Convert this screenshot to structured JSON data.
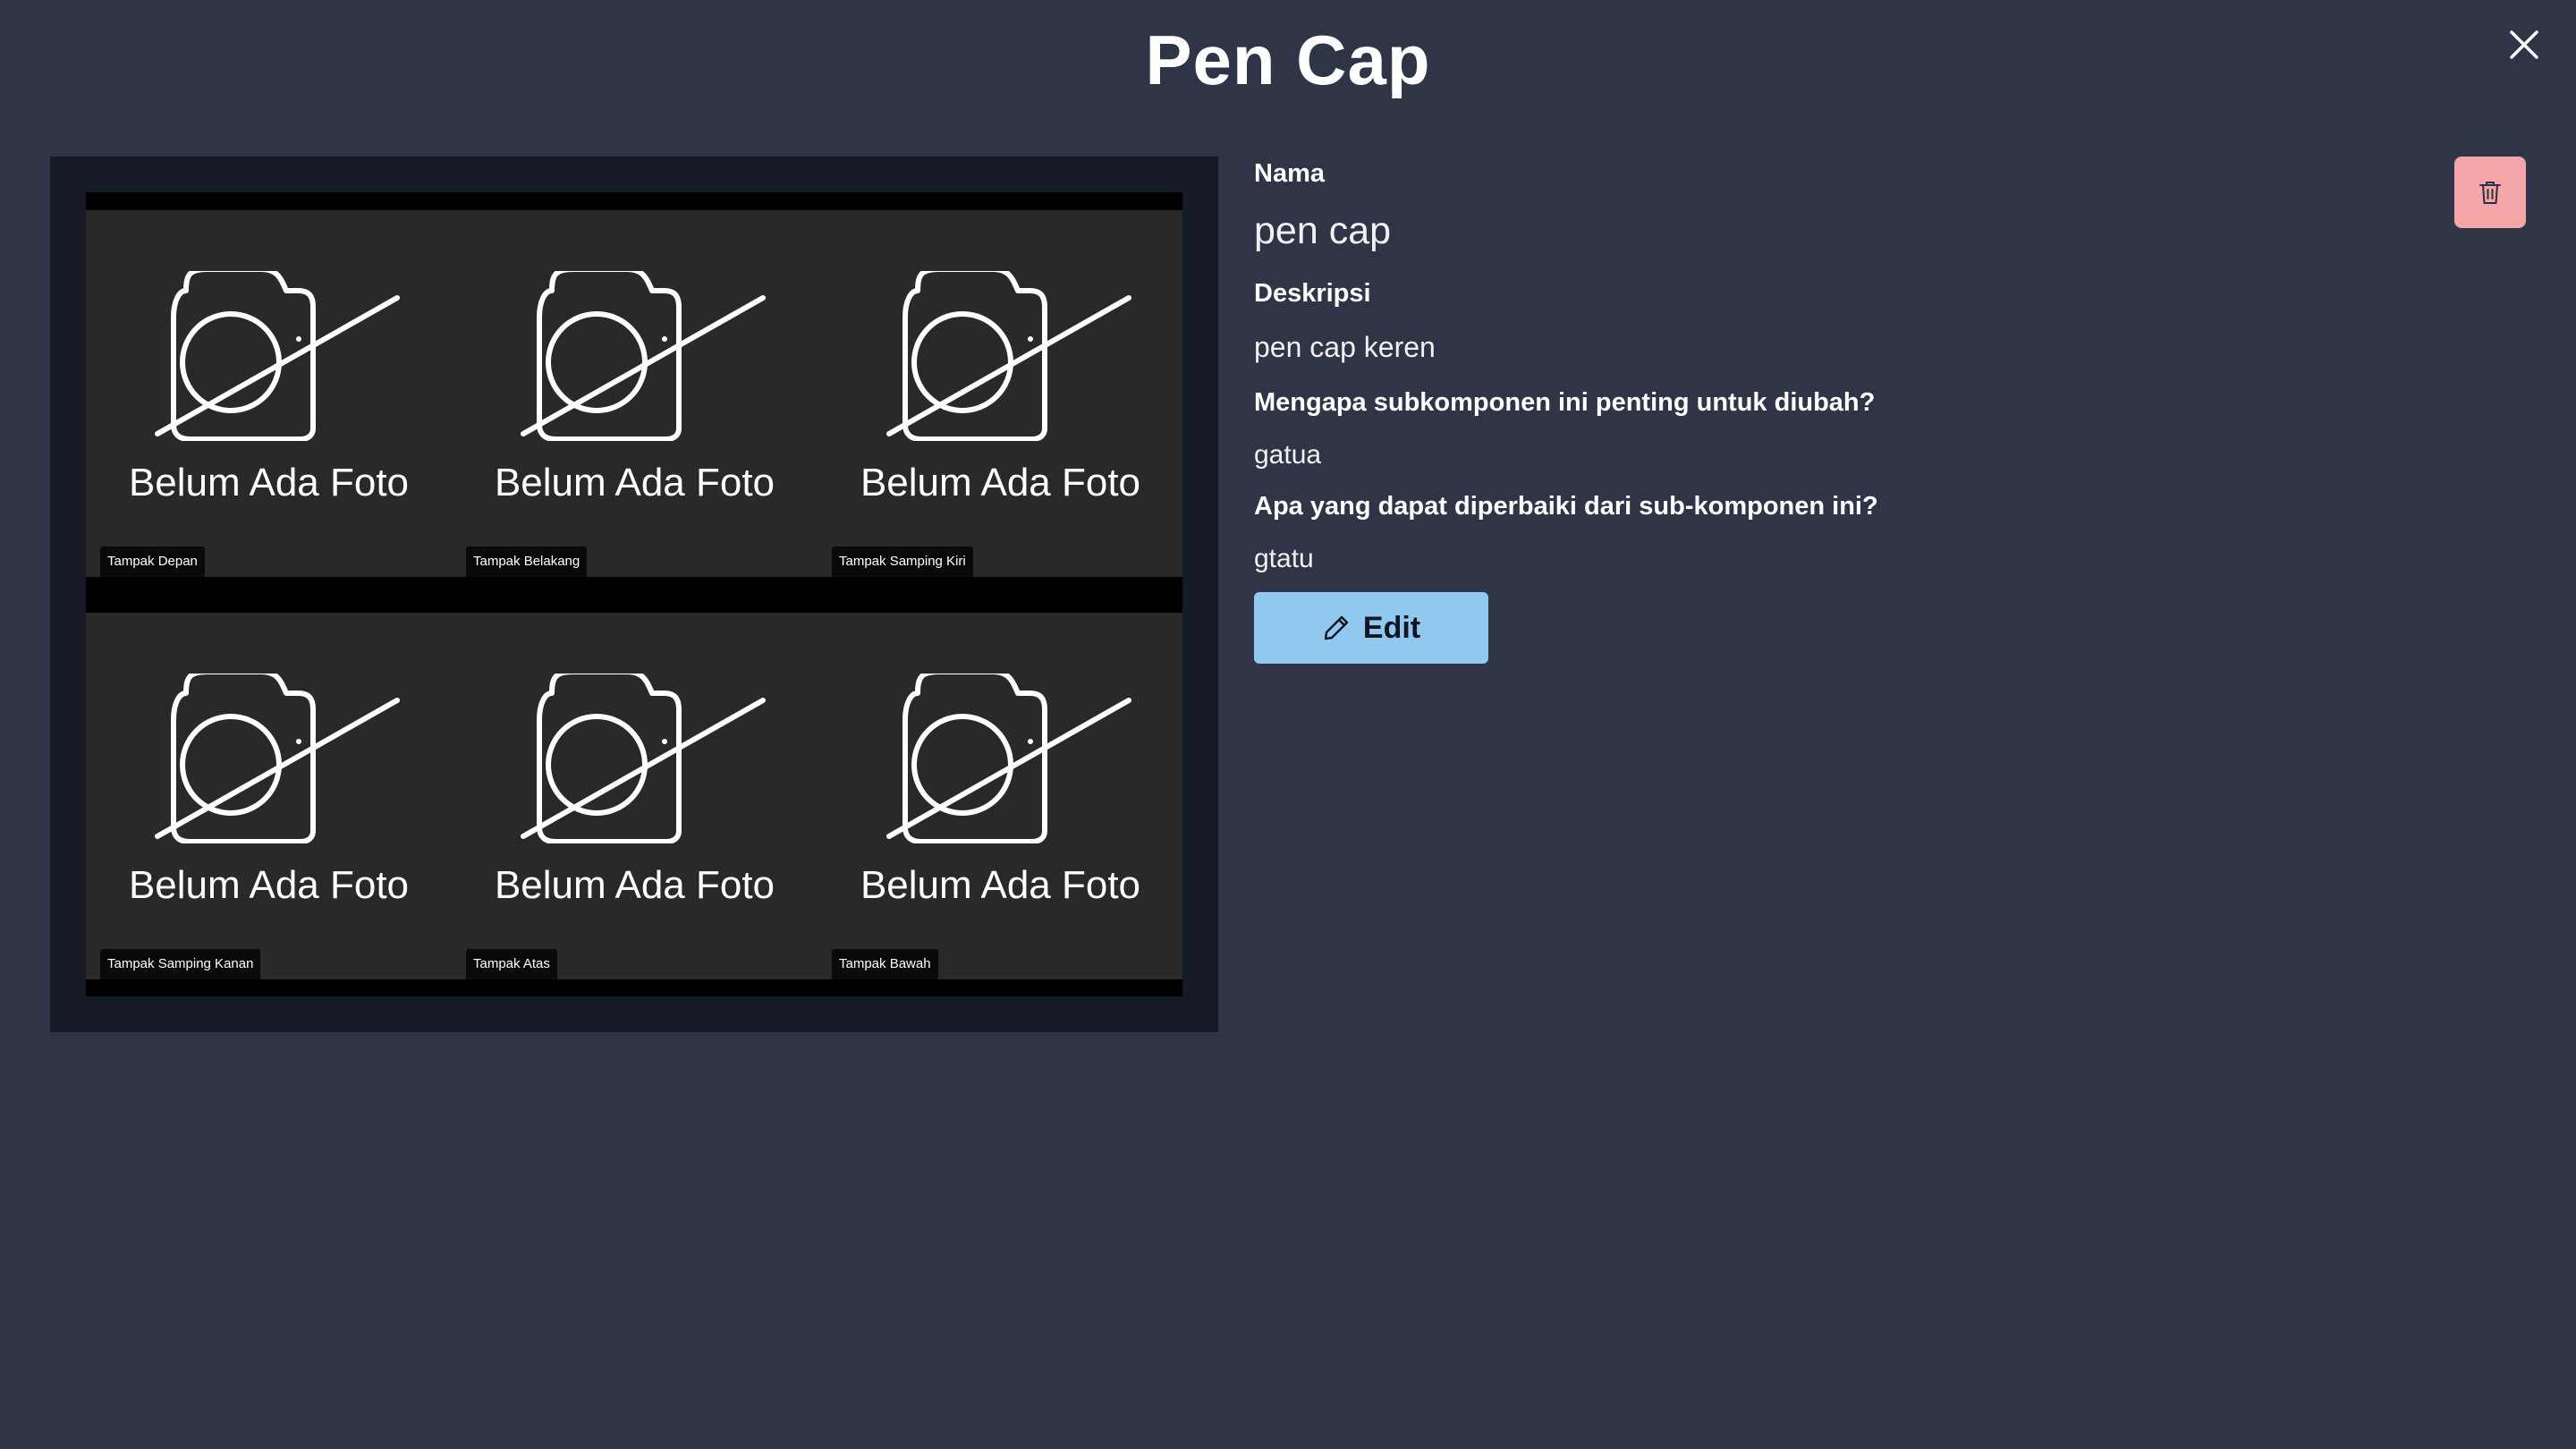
{
  "modal": {
    "title": "Pen Cap"
  },
  "icons": {
    "close": "close-icon",
    "photo_placeholder": "camera-off-icon",
    "edit": "pencil-icon",
    "delete": "trash-icon"
  },
  "gallery": {
    "photos": [
      {
        "caption": "Belum Ada Foto",
        "view": "Tampak Depan"
      },
      {
        "caption": "Belum Ada Foto",
        "view": "Tampak Belakang"
      },
      {
        "caption": "Belum Ada Foto",
        "view": "Tampak Samping Kiri"
      },
      {
        "caption": "Belum Ada Foto",
        "view": "Tampak Samping Kanan"
      },
      {
        "caption": "Belum Ada Foto",
        "view": "Tampak Atas"
      },
      {
        "caption": "Belum Ada Foto",
        "view": "Tampak Bawah"
      }
    ]
  },
  "details": {
    "name_label": "Nama",
    "name_value": "pen cap",
    "description_label": "Deskripsi",
    "description_value": "pen cap keren",
    "why_label": "Mengapa subkomponen ini penting untuk diubah?",
    "why_value": "gatua",
    "improve_label": "Apa yang dapat diperbaiki dari sub-komponen ini?",
    "improve_value": "gtatu"
  },
  "actions": {
    "edit_label": "Edit"
  },
  "colors": {
    "background": "#2f3546",
    "gallery_frame": "#151a26",
    "edit_button": "#90c8f0",
    "delete_button": "#f4a5a8"
  }
}
